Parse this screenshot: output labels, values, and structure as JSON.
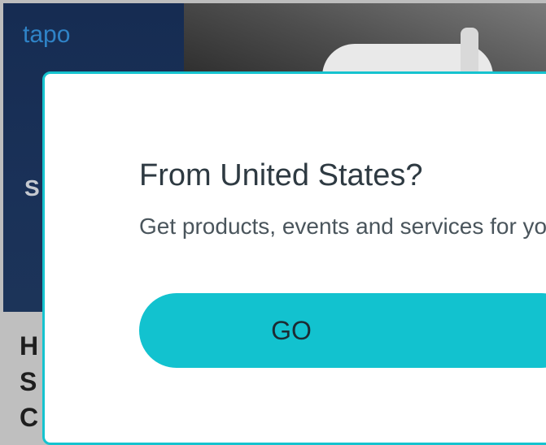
{
  "hero": {
    "brand": "tapo",
    "letter": "S"
  },
  "page": {
    "heading_peek": [
      "H",
      "S",
      "C"
    ]
  },
  "modal": {
    "title": "From United States?",
    "text": "Get products, events and services for your region.",
    "button_label": "GO"
  },
  "colors": {
    "accent": "#12c2cf",
    "border": "#15c3cf",
    "hero_bg": "#142a4f",
    "brand": "#2f83c7"
  }
}
